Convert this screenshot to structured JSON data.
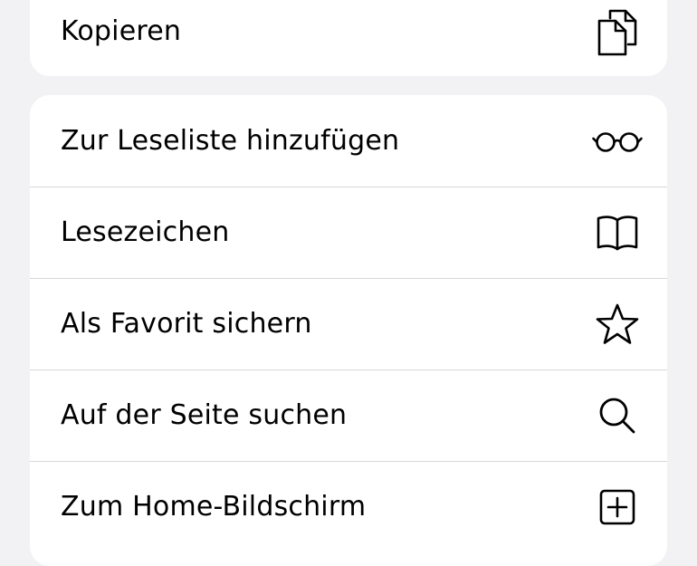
{
  "menu": {
    "top_group": [
      {
        "label": "Kopieren",
        "icon": "copy-icon"
      }
    ],
    "main_group": [
      {
        "label": "Zur Leseliste hinzufügen",
        "icon": "glasses-icon"
      },
      {
        "label": "Lesezeichen",
        "icon": "book-icon"
      },
      {
        "label": "Als Favorit sichern",
        "icon": "star-icon"
      },
      {
        "label": "Auf der Seite suchen",
        "icon": "magnifier-icon"
      },
      {
        "label": "Zum Home-Bildschirm",
        "icon": "plus-square-icon"
      }
    ]
  }
}
